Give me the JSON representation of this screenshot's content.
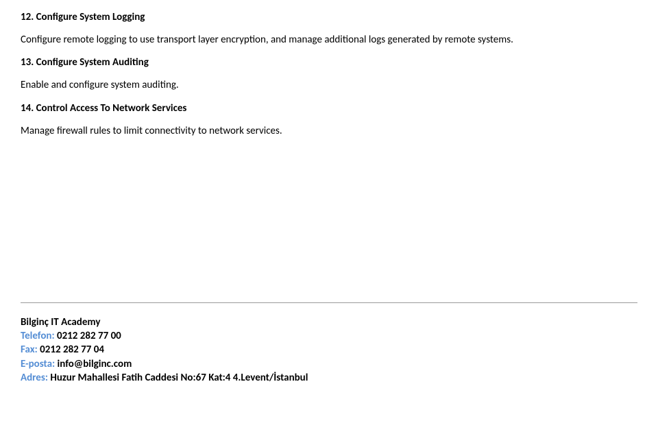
{
  "sections": {
    "s12": {
      "heading": "12. Configure System Logging",
      "body": "Configure remote logging to use transport layer encryption, and manage additional logs generated by remote systems."
    },
    "s13": {
      "heading": "13. Configure System Auditing",
      "body": "Enable and configure system auditing."
    },
    "s14": {
      "heading": "14. Control Access To Network Services",
      "body": "Manage firewall rules to limit connectivity to network services."
    }
  },
  "footer": {
    "academy": "Bilginç IT Academy",
    "phone_label": "Telefon: ",
    "phone_value": "0212 282 77 00",
    "fax_label": "Fax: ",
    "fax_value": "0212 282 77 04",
    "email_label": "E-posta: ",
    "email_value": "info@bilginc.com",
    "address_label": "Adres: ",
    "address_value": "Huzur Mahallesi Fatih Caddesi No:67 Kat:4 4.Levent/İstanbul"
  }
}
